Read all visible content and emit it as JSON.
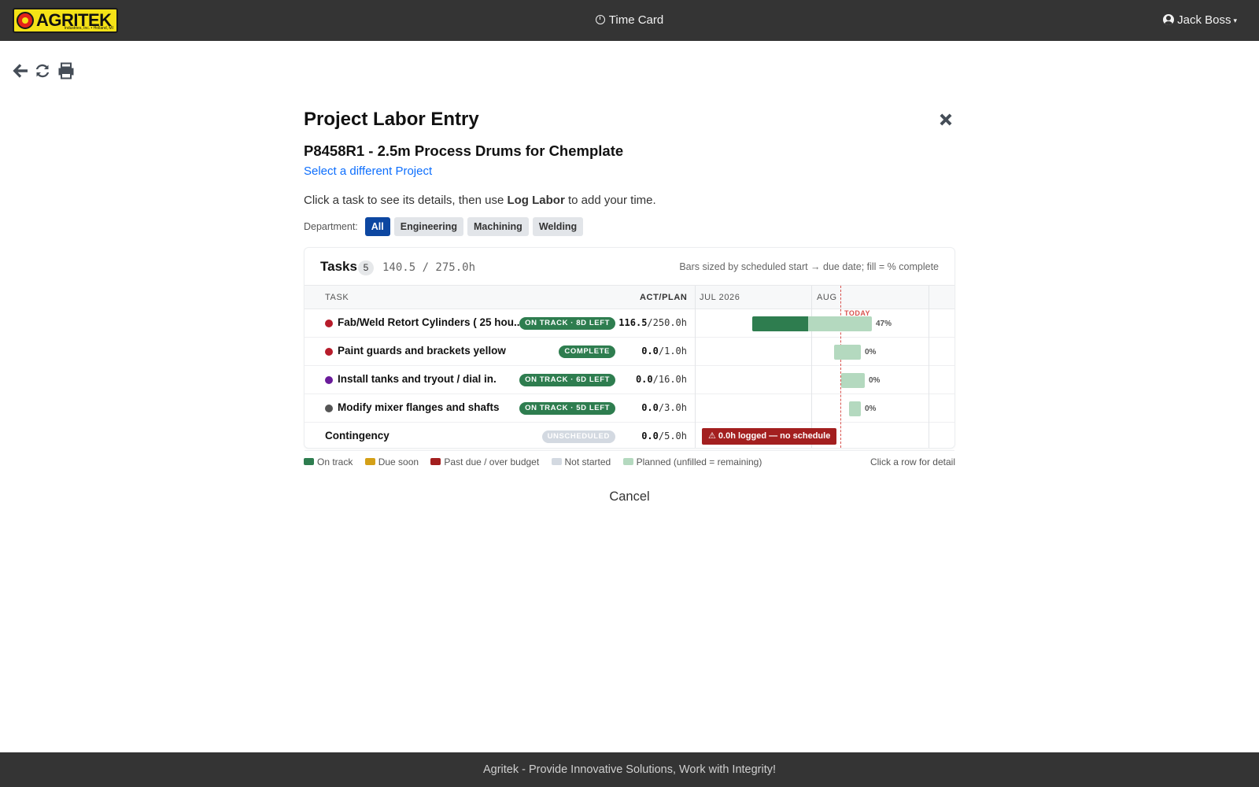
{
  "header": {
    "logo_text": "AGRITEK",
    "logo_subtext": "Industries, Inc. • Holland, MI",
    "nav_title": "Time Card",
    "user_name": "Jack Boss"
  },
  "toolbar": {
    "icons": [
      "back-arrow-icon",
      "refresh-icon",
      "print-icon"
    ]
  },
  "panel": {
    "title": "Project Labor Entry",
    "project_name": "P8458R1 - 2.5m Process Drums for Chemplate",
    "change_project_link": "Select a different Project",
    "instructions_pre": "Click a task to see its details, then use ",
    "instructions_bold": "Log Labor",
    "instructions_post": " to add your time.",
    "department_label": "Department:",
    "departments": [
      "All",
      "Engineering",
      "Machining",
      "Welding"
    ],
    "active_department": "All",
    "cancel_label": "Cancel"
  },
  "tasks_card": {
    "title": "Tasks",
    "count": "5",
    "hours_total": "140.5 / 275.0h",
    "note": "Bars sized by scheduled start → due date; fill = % complete",
    "columns": {
      "task": "TASK",
      "act_plan": "ACT/PLAN",
      "month1": "JUL 2026",
      "month2": "AUG"
    },
    "today_label": "TODAY",
    "rows": [
      {
        "name": "Fab/Weld Retort Cylinders ( 25 hou...",
        "dot_color": "#b71c2b",
        "status": "ON TRACK · 8D LEFT",
        "status_kind": "ontrack",
        "act": "116.5",
        "plan": "/250.0h",
        "pct": "47%"
      },
      {
        "name": "Paint guards and brackets yellow",
        "dot_color": "#b71c2b",
        "status": "COMPLETE",
        "status_kind": "complete",
        "act": "0.0",
        "plan": "/1.0h",
        "pct": "0%"
      },
      {
        "name": "Install tanks and tryout / dial in.",
        "dot_color": "#6a1b9a",
        "status": "ON TRACK · 6D LEFT",
        "status_kind": "ontrack",
        "act": "0.0",
        "plan": "/16.0h",
        "pct": "0%"
      },
      {
        "name": "Modify mixer flanges and shafts",
        "dot_color": "#555555",
        "status": "ON TRACK · 5D LEFT",
        "status_kind": "ontrack",
        "act": "0.0",
        "plan": "/3.0h",
        "pct": "0%"
      },
      {
        "name": "Contingency",
        "dot_color": "",
        "status": "UNSCHEDULED",
        "status_kind": "unscheduled",
        "act": "0.0",
        "plan": "/5.0h",
        "no_schedule_label": "⚠ 0.0h logged — no schedule"
      }
    ]
  },
  "legend": {
    "items": [
      {
        "label": "On track",
        "color": "#2e7d4f"
      },
      {
        "label": "Due soon",
        "color": "#d4a017"
      },
      {
        "label": "Past due / over budget",
        "color": "#a31f1f"
      },
      {
        "label": "Not started",
        "color": "#d3d9e1"
      },
      {
        "label": "Planned (unfilled = remaining)",
        "color": "#b4d9bf"
      }
    ],
    "hint": "Click a row for detail"
  },
  "footer": {
    "text": "Agritek - Provide Innovative Solutions, Work with Integrity!"
  }
}
